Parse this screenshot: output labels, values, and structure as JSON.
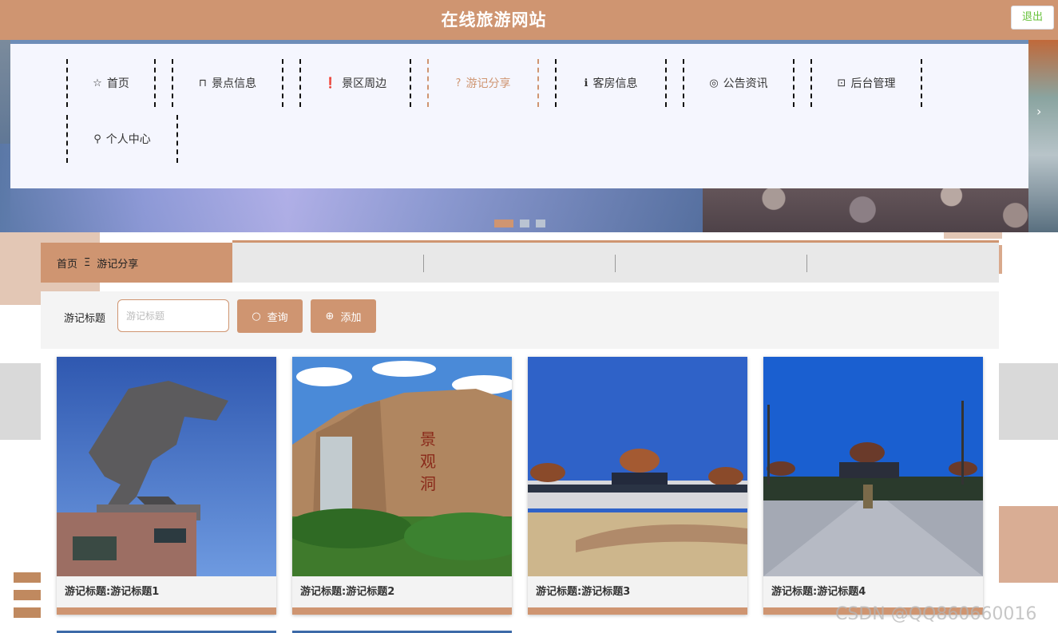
{
  "header": {
    "title": "在线旅游网站",
    "logout_label": "退出"
  },
  "nav": {
    "items": [
      {
        "label": "首页",
        "icon": "star-icon",
        "glyph": "☆"
      },
      {
        "label": "景点信息",
        "icon": "bag-icon",
        "glyph": "⊓"
      },
      {
        "label": "景区周边",
        "icon": "warning-icon",
        "glyph": "❗"
      },
      {
        "label": "游记分享",
        "icon": "question-icon",
        "glyph": "?"
      },
      {
        "label": "客房信息",
        "icon": "info-icon",
        "glyph": "ℹ"
      },
      {
        "label": "公告资讯",
        "icon": "cog-icon",
        "glyph": "◎"
      },
      {
        "label": "后台管理",
        "icon": "briefcase-icon",
        "glyph": "⊡"
      },
      {
        "label": "个人中心",
        "icon": "user-icon",
        "glyph": "⚲"
      }
    ],
    "active": "游记分享",
    "active_color": "#cf9571"
  },
  "carousel": {
    "next_glyph": "›",
    "slides": 3,
    "active_slide": 1
  },
  "breadcrumb": {
    "home": "首页",
    "separator": "Ξ",
    "current": "游记分享"
  },
  "search": {
    "label": "游记标题",
    "placeholder": "游记标题",
    "value": "",
    "query_label": "查询",
    "query_glyph": "○",
    "add_label": "添加",
    "add_glyph": "⊕"
  },
  "cards": [
    {
      "title": "游记标题:游记标题1",
      "image": "horse-statue"
    },
    {
      "title": "游记标题:游记标题2",
      "image": "waterfall-cliff"
    },
    {
      "title": "游记标题:游记标题3",
      "image": "mongolian-palace"
    },
    {
      "title": "游记标题:游记标题4",
      "image": "palace-plaza"
    }
  ],
  "watermark": "CSDN @QQ860660016",
  "colors": {
    "brand": "#cf9571",
    "nav_bg": "#f5f6fe",
    "logout_text": "#67c23a"
  }
}
